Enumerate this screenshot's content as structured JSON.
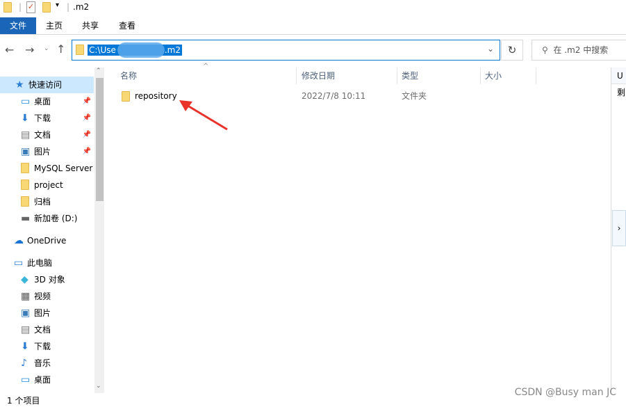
{
  "title": ".m2",
  "ribbon_tabs": [
    {
      "label": "文件",
      "active": true
    },
    {
      "label": "主页"
    },
    {
      "label": "共享"
    },
    {
      "label": "查看"
    }
  ],
  "address": {
    "prefix": "C:\\Use",
    "suffix": ".m2"
  },
  "search": {
    "placeholder": "在 .m2 中搜索"
  },
  "sidebar": [
    {
      "label": "快速访问",
      "icon": "star-icon",
      "selected": true
    },
    {
      "label": "桌面",
      "icon": "desktop-icon",
      "pinned": true
    },
    {
      "label": "下载",
      "icon": "download-icon",
      "pinned": true
    },
    {
      "label": "文档",
      "icon": "document-icon",
      "pinned": true
    },
    {
      "label": "图片",
      "icon": "picture-icon",
      "pinned": true
    },
    {
      "label": "MySQL Server",
      "icon": "folder-icon"
    },
    {
      "label": "project",
      "icon": "folder-icon"
    },
    {
      "label": "归档",
      "icon": "folder-icon"
    },
    {
      "label": "新加卷 (D:)",
      "icon": "drive-icon"
    },
    {
      "label": "OneDrive",
      "icon": "cloud-icon"
    },
    {
      "label": "此电脑",
      "icon": "computer-icon"
    },
    {
      "label": "3D 对象",
      "icon": "cube-icon"
    },
    {
      "label": "视频",
      "icon": "video-icon"
    },
    {
      "label": "图片",
      "icon": "picture-icon"
    },
    {
      "label": "文档",
      "icon": "document-icon"
    },
    {
      "label": "下载",
      "icon": "download-icon"
    },
    {
      "label": "音乐",
      "icon": "music-icon"
    },
    {
      "label": "桌面",
      "icon": "desktop-icon"
    }
  ],
  "columns": [
    "名称",
    "修改日期",
    "类型",
    "大小"
  ],
  "files": [
    {
      "name": "repository",
      "modified": "2022/7/8 10:11",
      "type": "文件夹",
      "size": ""
    }
  ],
  "right_panel": [
    "U盘",
    "剩"
  ],
  "status": "1 个项目",
  "watermark": "CSDN @Busy man JC",
  "colors": {
    "accent": "#0078d7",
    "arrow": "#e8322a"
  }
}
